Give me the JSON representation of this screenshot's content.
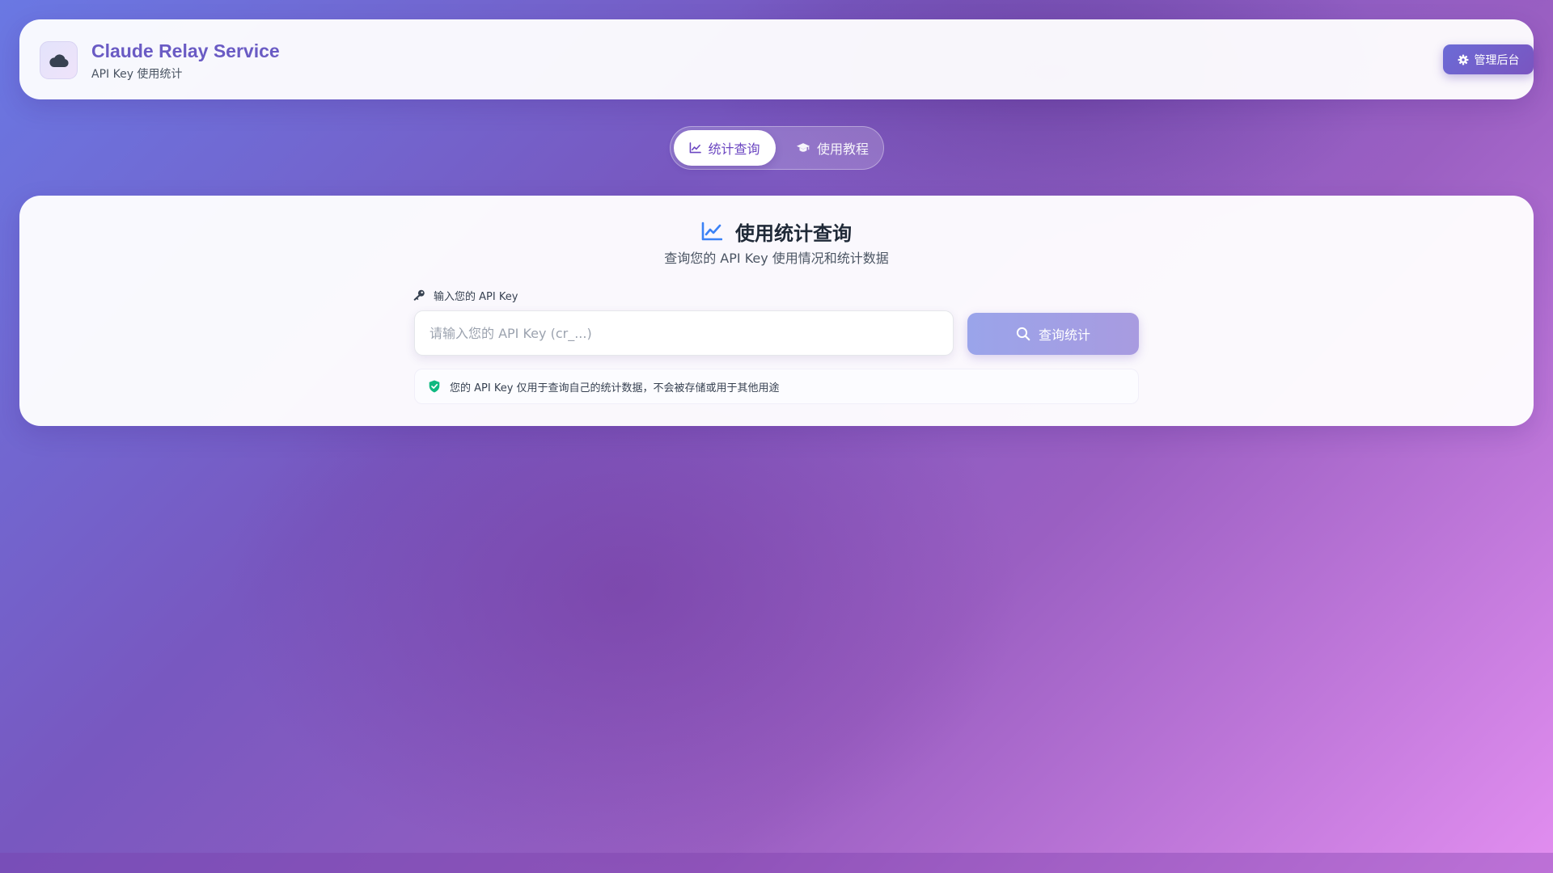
{
  "header": {
    "title": "Claude Relay Service",
    "subtitle": "API Key 使用统计",
    "logo_icon": "cloud-icon",
    "admin_button": {
      "label": "管理后台",
      "icon": "gear-icon"
    }
  },
  "tabs": [
    {
      "label": "统计查询",
      "icon": "chart-line-icon",
      "active": true
    },
    {
      "label": "使用教程",
      "icon": "graduation-cap-icon",
      "active": false
    }
  ],
  "main": {
    "title": "使用统计查询",
    "title_icon": "chart-line-icon",
    "description": "查询您的 API Key 使用情况和统计数据",
    "field_label": "输入您的 API Key",
    "field_icon": "key-icon",
    "input": {
      "value": "",
      "placeholder": "请输入您的 API Key (cr_...)"
    },
    "query_button": {
      "label": "查询统计",
      "icon": "search-icon"
    },
    "notice": {
      "text": "您的 API Key 仅用于查询自己的统计数据，不会被存储或用于其他用途",
      "icon": "shield-check-icon"
    }
  },
  "colors": {
    "brand": "#6a5bc4",
    "accent": "#7a55c0",
    "success": "#10b981",
    "title_icon": "#3b82f6"
  }
}
